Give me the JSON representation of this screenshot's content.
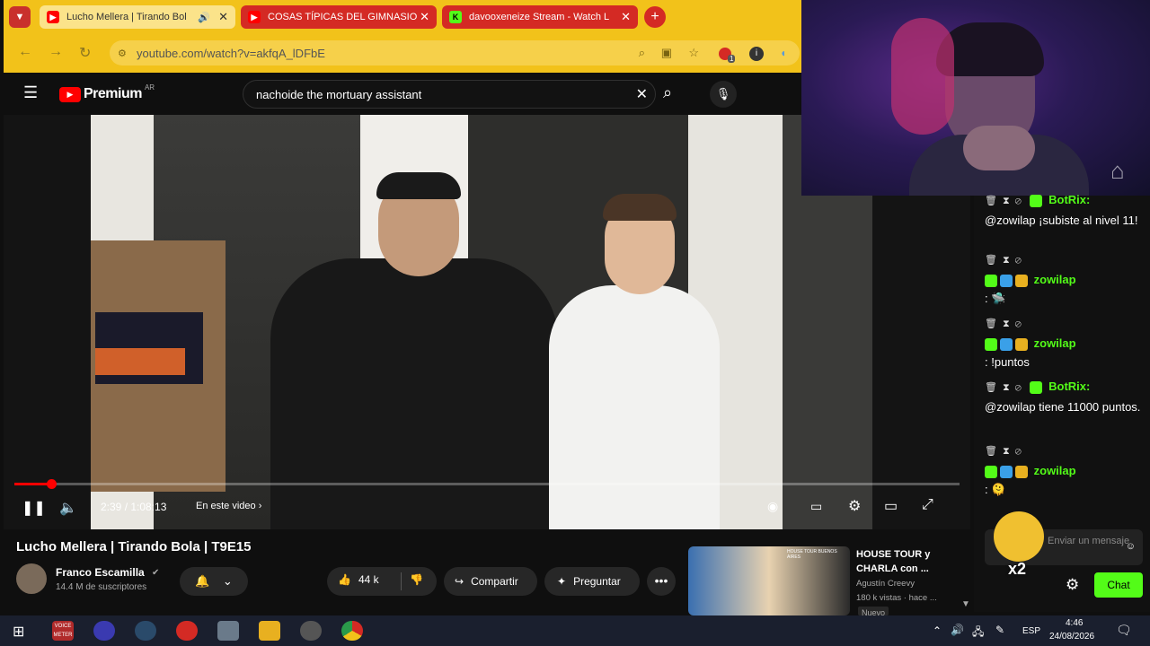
{
  "browser": {
    "tabs": [
      {
        "label": "Lucho Mellera | Tirando Bol",
        "active": true
      },
      {
        "label": "COSAS TÍPICAS DEL GIMNASIO",
        "active": false
      },
      {
        "label": "davooxeneize Stream - Watch L",
        "active": false
      }
    ],
    "url": "youtube.com/watch?v=akfqA_lDFbE",
    "extension_badge": "1"
  },
  "youtube": {
    "logo": "Premium",
    "region": "AR",
    "search_value": "nachoide the mortuary assistant"
  },
  "player": {
    "time": "2:39 / 1:08:13",
    "chapters_label": "En este video",
    "progress": 0.039
  },
  "video_meta": {
    "title": "Lucho Mellera | Tirando Bola | T9E15",
    "channel": "Franco Escamilla",
    "subscribers": "14.4 M de suscriptores",
    "likes": "44 k",
    "share_label": "Compartir",
    "ask_label": "Preguntar"
  },
  "recommendation": {
    "title": "HOUSE TOUR y CHARLA con ...",
    "channel": "Agustín Creevy",
    "stats": "180 k vistas · hace ...",
    "thumb_text": "HOUSE TOUR BUENOS AIRES",
    "chip": "Nuevo"
  },
  "chat": {
    "messages": [
      {
        "user": "BotRix:",
        "text": "@zowilap ¡subiste al nivel 11!"
      },
      {
        "user": "zowilap",
        "text": ":"
      },
      {
        "user": "zowilap",
        "text": ": !puntos"
      },
      {
        "user": "BotRix:",
        "text": "@zowilap tiene 11000 puntos."
      },
      {
        "user": "zowilap",
        "text": ":"
      }
    ],
    "input_placeholder": "Enviar un mensaje",
    "multiplier": "x2",
    "chat_button": "Chat"
  },
  "taskbar": {
    "language": "ESP",
    "time": "4:46",
    "date": "24/08/2026",
    "voicemeeter_label": "VOICE METER"
  },
  "colors": {
    "browser_accent": "#f2c21a",
    "youtube_red": "#ff0000",
    "kick_green": "#53fc18"
  }
}
